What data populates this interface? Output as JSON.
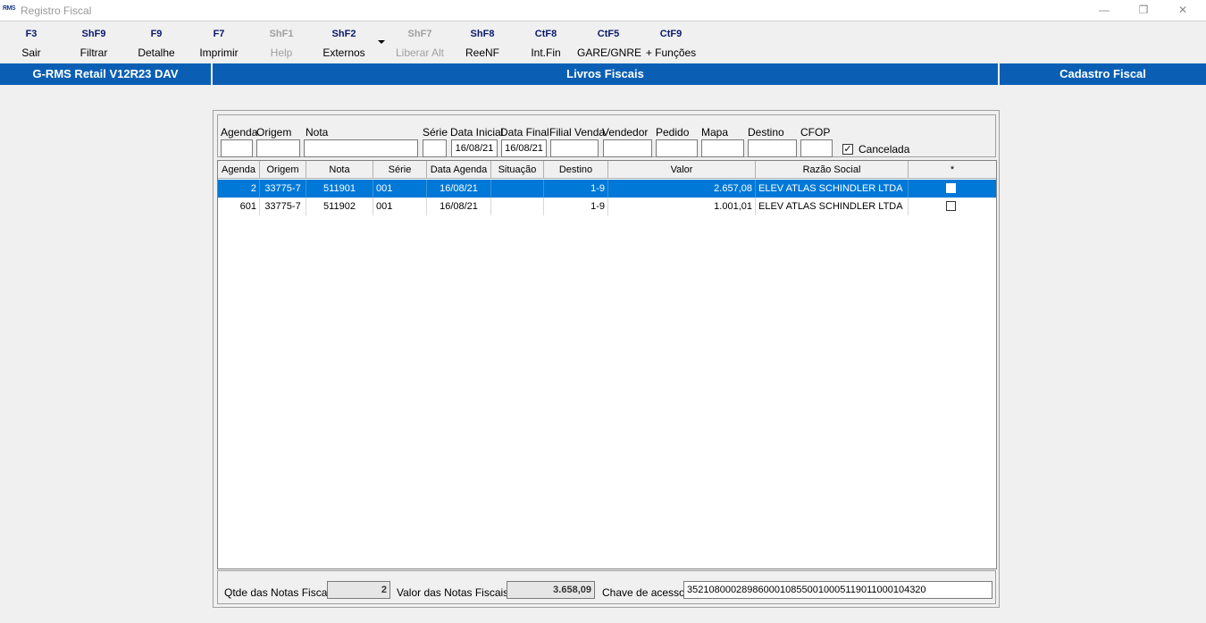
{
  "window": {
    "logo": "RMS",
    "title": "Registro Fiscal",
    "min": "—",
    "restore": "❐",
    "close": "✕"
  },
  "toolbar": [
    {
      "key": "F3",
      "label": "Sair",
      "enabled": true
    },
    {
      "key": "ShF9",
      "label": "Filtrar",
      "enabled": true
    },
    {
      "key": "F9",
      "label": "Detalhe",
      "enabled": true
    },
    {
      "key": "F7",
      "label": "Imprimir",
      "enabled": true
    },
    {
      "key": "ShF1",
      "label": "Help",
      "enabled": false
    },
    {
      "key": "ShF2",
      "label": "Externos",
      "enabled": true
    },
    {
      "key": "ShF7",
      "label": "Liberar Alt",
      "enabled": false
    },
    {
      "key": "ShF8",
      "label": "ReeNF",
      "enabled": true
    },
    {
      "key": "CtF8",
      "label": "Int.Fin",
      "enabled": true
    },
    {
      "key": "CtF5",
      "label": "GARE/GNRE",
      "enabled": true
    },
    {
      "key": "CtF9",
      "label": "+ Funções",
      "enabled": true
    }
  ],
  "band": {
    "left": "G-RMS Retail V12R23 DAV",
    "center": "Livros Fiscais",
    "right": "Cadastro Fiscal"
  },
  "filters": {
    "agenda": {
      "label": "Agenda",
      "value": ""
    },
    "origem": {
      "label": "Origem",
      "value": ""
    },
    "nota": {
      "label": "Nota",
      "value": ""
    },
    "serie": {
      "label": "Série",
      "value": ""
    },
    "data_inicial": {
      "label": "Data Inicial",
      "value": "16/08/21"
    },
    "data_final": {
      "label": "Data Final",
      "value": "16/08/21"
    },
    "filial_venda": {
      "label": "Filial Venda",
      "value": ""
    },
    "vendedor": {
      "label": "Vendedor",
      "value": ""
    },
    "pedido": {
      "label": "Pedido",
      "value": ""
    },
    "mapa": {
      "label": "Mapa",
      "value": ""
    },
    "destino": {
      "label": "Destino",
      "value": ""
    },
    "cfop": {
      "label": "CFOP",
      "value": ""
    },
    "cancelada": {
      "label": "Cancelada",
      "checked": true,
      "mark": "✓"
    }
  },
  "grid": {
    "columns": [
      "Agenda",
      "Origem",
      "Nota",
      "Série",
      "Data Agenda",
      "Situação",
      "Destino",
      "Valor",
      "Razão Social",
      "*"
    ],
    "rows": [
      {
        "agenda": "2",
        "origem": "33775-7",
        "nota": "511901",
        "serie": "001",
        "data_agenda": "16/08/21",
        "situacao": "",
        "destino": "1-9",
        "valor": "2.657,08",
        "razao_social": "ELEV ATLAS SCHINDLER LTDA",
        "checked": false,
        "selected": true
      },
      {
        "agenda": "601",
        "origem": "33775-7",
        "nota": "511902",
        "serie": "001",
        "data_agenda": "16/08/21",
        "situacao": "",
        "destino": "1-9",
        "valor": "1.001,01",
        "razao_social": "ELEV ATLAS SCHINDLER LTDA",
        "checked": false,
        "selected": false
      }
    ]
  },
  "footer": {
    "qtde_label": "Qtde das Notas Fiscais:",
    "qtde_value": "2",
    "valor_label": "Valor  das Notas Fiscais:",
    "valor_value": "3.658,09",
    "chave_label": "Chave de acesso:",
    "chave_value": "35210800028986000108550010005119011000104320"
  }
}
